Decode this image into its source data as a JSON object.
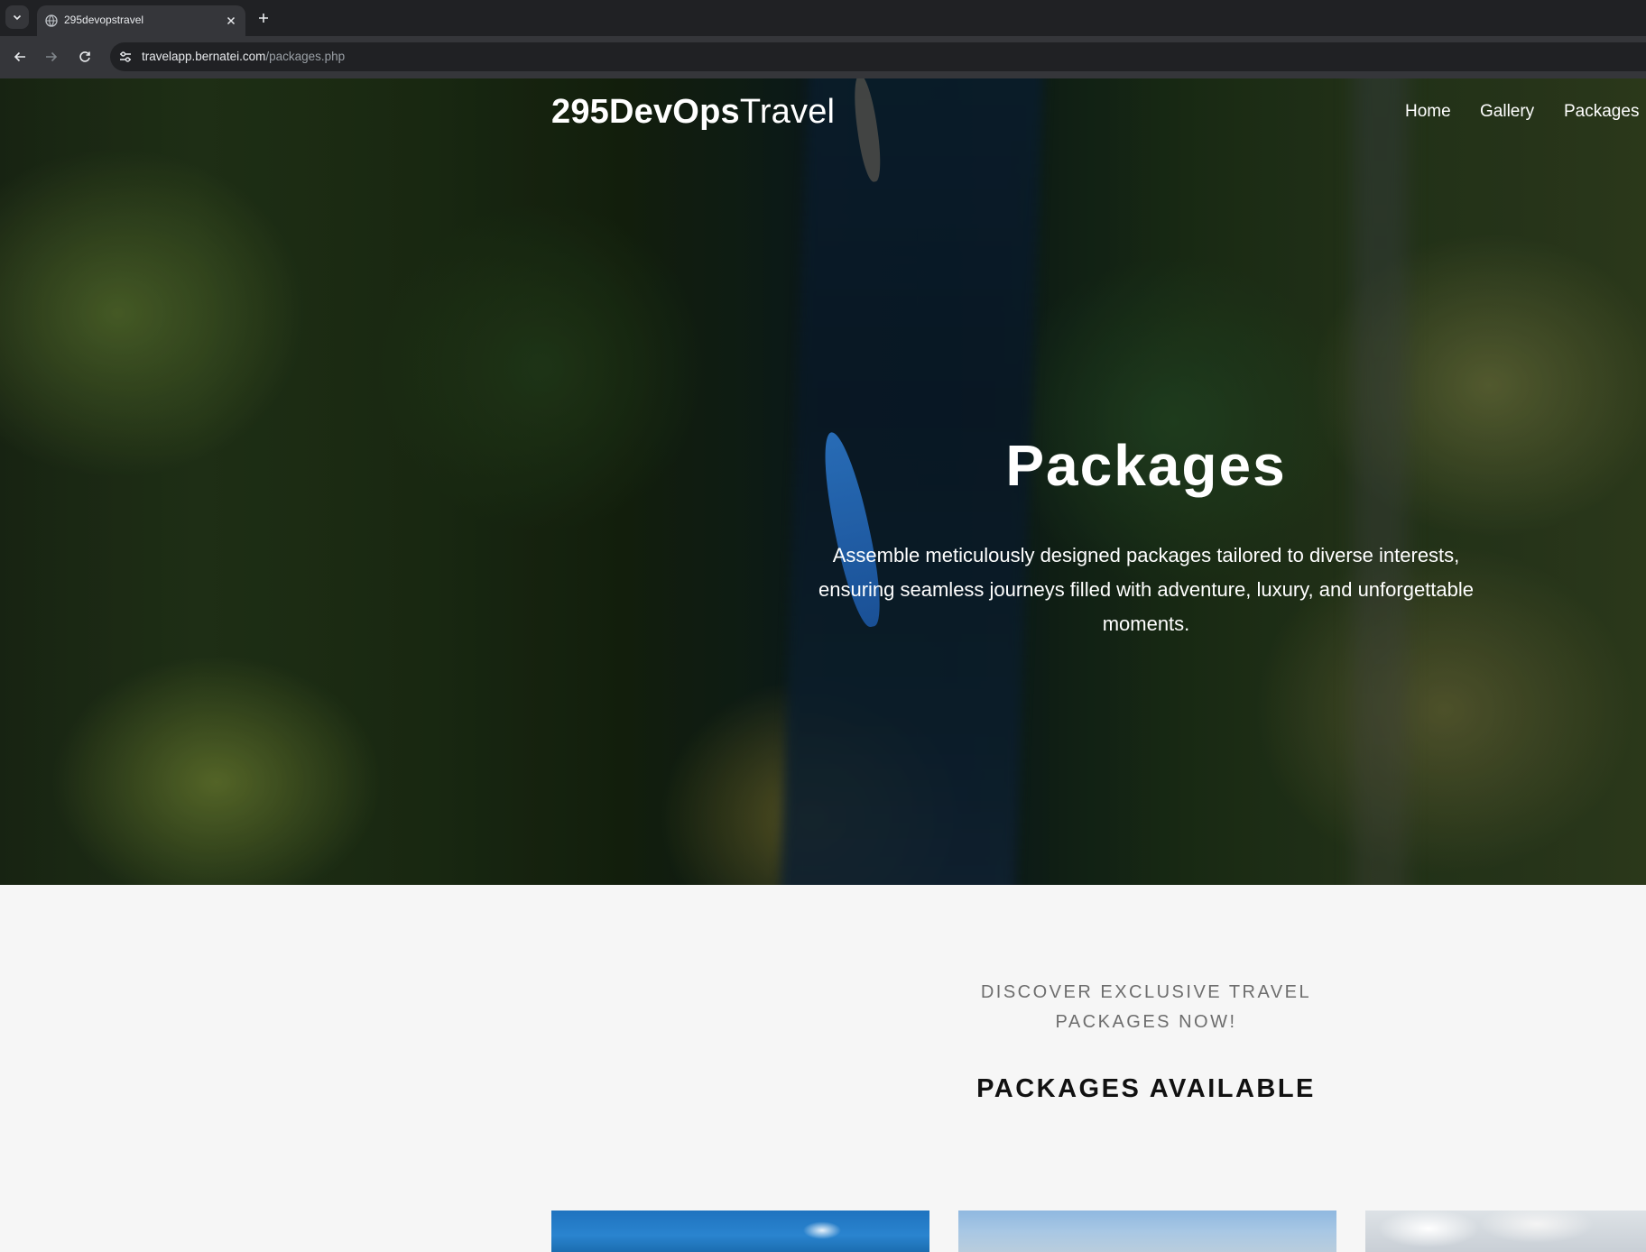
{
  "browser": {
    "tab_title": "295devopstravel",
    "url_host": "travelapp.bernatei.com",
    "url_path": "/packages.php"
  },
  "site": {
    "brand_bold": "295DevOps",
    "brand_light": "Travel",
    "nav": [
      {
        "label": "Home"
      },
      {
        "label": "Gallery"
      },
      {
        "label": "Packages"
      }
    ]
  },
  "hero": {
    "title": "Packages",
    "description": "Assemble meticulously designed packages tailored to diverse interests, ensuring seamless journeys filled with adventure, luxury, and unforgettable moments."
  },
  "section": {
    "eyebrow": "DISCOVER EXCLUSIVE TRAVEL PACKAGES NOW!",
    "title": "PACKAGES AVAILABLE"
  },
  "colors": {
    "tab_bar": "#202124",
    "toolbar": "#35363a",
    "page_background": "#f6f6f6",
    "hero_text": "#ffffff",
    "eyebrow_text": "#6d6d6d",
    "section_title": "#111111"
  },
  "icons": {
    "tab_menu": "chevron-down-icon",
    "favicon": "globe-icon",
    "tab_close": "close-icon",
    "new_tab": "plus-icon",
    "back": "arrow-left-icon",
    "forward": "arrow-right-icon",
    "reload": "reload-icon",
    "site_info": "tune-icon"
  }
}
